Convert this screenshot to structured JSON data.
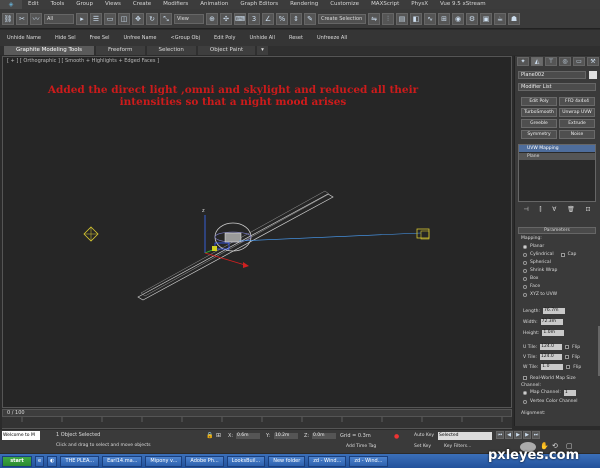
{
  "menu": {
    "items": [
      "Edit",
      "Tools",
      "Group",
      "Views",
      "Create",
      "Modifiers",
      "Animation",
      "Graph Editors",
      "Rendering",
      "Customize",
      "MAXScript",
      "PhysX",
      "Vue 9.5 xStream"
    ]
  },
  "toolbar": {
    "selection_filter": "All",
    "ref_coord": "View",
    "named_selection": "Create Selection"
  },
  "command_row": {
    "buttons": [
      "Unhide Name",
      "Hide Sel",
      "Free Sel",
      "Unfree Name",
      "<Group Obj",
      "Edit Poly",
      "Unhide All",
      "Reset",
      "Unfreeze All"
    ]
  },
  "ribbon": {
    "tabs": [
      "Graphite Modeling Tools",
      "Freeform",
      "Selection",
      "Object Paint"
    ]
  },
  "viewport": {
    "label": "[ + ] [ Orthographic ] [ Smooth + Highlights + Edged Faces ]",
    "note": "Added the direct light ,omni and skylight and reduced all their intensities so that a night mood arises"
  },
  "panel": {
    "object_name": "Plane002",
    "modifier_list_label": "Modifier List",
    "modifier_buttons": [
      "Edit Poly",
      "FFD 4x4x4",
      "TurboSmooth",
      "Unwrap UVW",
      "Greeble",
      "Extrude",
      "Symmetry",
      "Noise"
    ],
    "stack": [
      "UVW Mapping",
      "Plane"
    ],
    "parameters_title": "Parameters",
    "mapping_label": "Mapping:",
    "mapping_options": [
      "Planar",
      "Cylindrical",
      "Spherical",
      "Shrink Wrap",
      "Box",
      "Face",
      "XYZ to UVW"
    ],
    "cap_label": "Cap",
    "length_label": "Length:",
    "length_value": "76.7m",
    "width_label": "Width:",
    "width_value": "72.3m",
    "height_label": "Height:",
    "height_value": "1.0m",
    "utile_label": "U Tile:",
    "utile_value": "124.0",
    "vtile_label": "V Tile:",
    "vtile_value": "124.0",
    "wtile_label": "W Tile:",
    "wtile_value": "1.0",
    "flip_label": "Flip",
    "real_world_label": "Real-World Map Size",
    "channel_label": "Channel:",
    "map_channel_label": "Map Channel:",
    "map_channel_value": "1",
    "vertex_color_label": "Vertex Color Channel",
    "alignment_label": "Alignment:"
  },
  "timeline": {
    "frame_label": "0 / 100"
  },
  "status": {
    "selection_text": "1 Object Selected",
    "prompt": "Click and drag to select and move objects",
    "x_label": "X:",
    "x_value": "0.6m",
    "y_label": "Y:",
    "y_value": "10.2m",
    "z_label": "Z:",
    "z_value": "0.0m",
    "grid_text": "Grid = 0.3m",
    "auto_key": "Auto Key",
    "selected_dropdown": "Selected",
    "set_key": "Set Key",
    "key_filters": "Key Filters...",
    "add_time_tag": "Add Time Tag",
    "welcome": "Welcome to M"
  },
  "taskbar": {
    "start": "start",
    "items": [
      "THE PLEA...",
      "Earl14.ma...",
      "Mipony v...",
      "Adobe Ph...",
      "LooksBuil...",
      "New folder",
      "zd - Wind...",
      "zd - Wind..."
    ]
  },
  "watermark": "pxleyes.com",
  "colors": {
    "note_red": "#cc1b1b",
    "light_path_blue": "#4aa3ff",
    "accent_yellow": "#d8c830"
  }
}
